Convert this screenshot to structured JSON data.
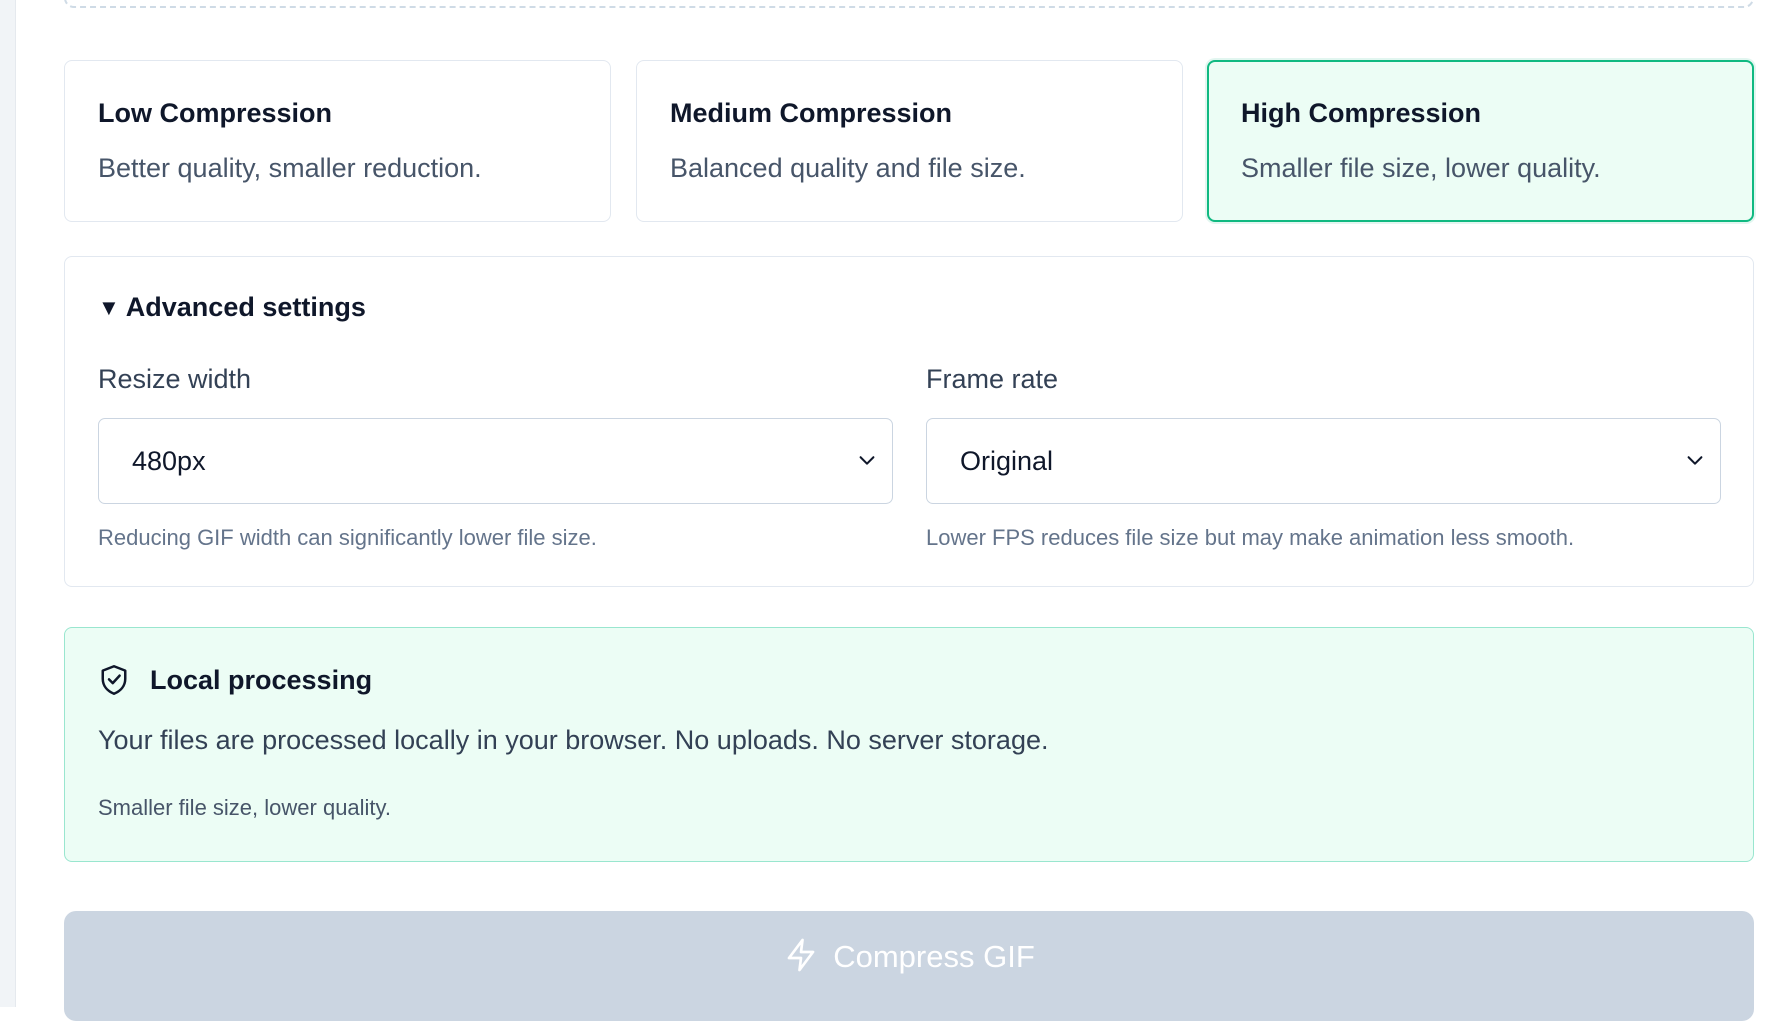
{
  "compression_options": [
    {
      "title": "Low Compression",
      "description": "Better quality, smaller reduction.",
      "selected": false
    },
    {
      "title": "Medium Compression",
      "description": "Balanced quality and file size.",
      "selected": false
    },
    {
      "title": "High Compression",
      "description": "Smaller file size, lower quality.",
      "selected": true
    }
  ],
  "advanced": {
    "summary": "Advanced settings",
    "resize_width": {
      "label": "Resize width",
      "value": "480px",
      "hint": "Reducing GIF width can significantly lower file size."
    },
    "frame_rate": {
      "label": "Frame rate",
      "value": "Original",
      "hint": "Lower FPS reduces file size but may make animation less smooth."
    }
  },
  "local_processing": {
    "title": "Local processing",
    "text": "Your files are processed locally in your browser. No uploads. No server storage.",
    "subtext": "Smaller file size, lower quality."
  },
  "compress_button": {
    "label": "Compress GIF",
    "enabled": false
  },
  "colors": {
    "accent": "#10b981",
    "selected_bg": "#ecfdf5",
    "button_disabled": "#cbd5e1"
  },
  "icons": [
    "triangle-down-icon",
    "chevron-down-icon",
    "shield-check-icon",
    "lightning-icon"
  ]
}
